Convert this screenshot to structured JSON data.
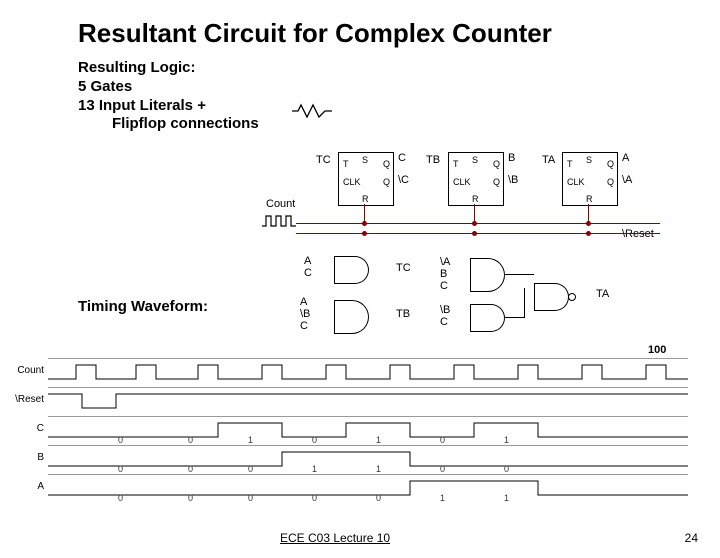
{
  "title": "Resultant Circuit for Complex Counter",
  "bullets": {
    "heading": "Resulting Logic:",
    "l1": "5 Gates",
    "l2": "13 Input Literals +",
    "l3": "Flipflop connections"
  },
  "count_label": "Count",
  "reset_label": "\\Reset",
  "timing_heading": "Timing Waveform:",
  "flipflops": [
    {
      "name": "TC",
      "q": "C",
      "qbar": "\\C"
    },
    {
      "name": "TB",
      "q": "B",
      "qbar": "\\B"
    },
    {
      "name": "TA",
      "q": "A",
      "qbar": "\\A"
    }
  ],
  "ff_pins": {
    "T": "T",
    "S": "S",
    "Q": "Q",
    "CLK": "CLK",
    "Qbar": "Q",
    "R": "R"
  },
  "gates": {
    "g_tc": {
      "inputs": [
        "A",
        "C"
      ],
      "output": "TC"
    },
    "g_tb": {
      "inputs": [
        "A",
        "\\B",
        "C"
      ],
      "output": "TB"
    },
    "g_ta1": {
      "inputs": [
        "\\A",
        "B",
        "C"
      ],
      "output": ""
    },
    "g_ta2": {
      "inputs": [
        "\\B",
        "C"
      ],
      "output": ""
    },
    "g_ta_out": {
      "output": "TA"
    }
  },
  "timing": {
    "hundred": "100",
    "rows": [
      {
        "name": "Count",
        "digits": []
      },
      {
        "name": "\\Reset",
        "digits": []
      },
      {
        "name": "C",
        "digits": [
          "0",
          "0",
          "1",
          "0",
          "1",
          "0",
          "1"
        ]
      },
      {
        "name": "B",
        "digits": [
          "0",
          "0",
          "0",
          "1",
          "1",
          "0",
          "0"
        ]
      },
      {
        "name": "A",
        "digits": [
          "0",
          "0",
          "0",
          "0",
          "0",
          "1",
          "1"
        ]
      }
    ]
  },
  "footer": "ECE C03 Lecture 10",
  "page": "24"
}
